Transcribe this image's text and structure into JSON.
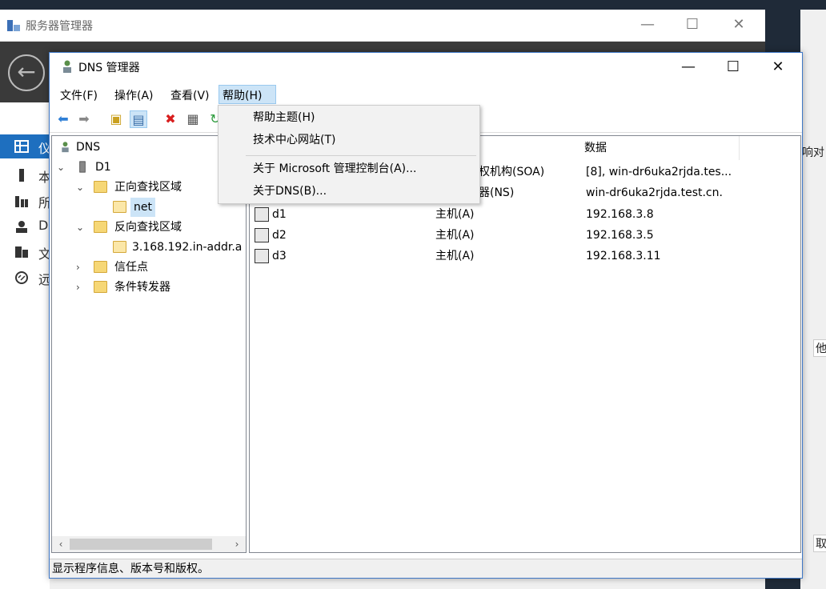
{
  "server_manager": {
    "title": "服务器管理器",
    "nav": [
      {
        "label": "仪",
        "icon": "dashboard-icon",
        "active": true
      },
      {
        "label": "本",
        "icon": "local-server-icon"
      },
      {
        "label": "所",
        "icon": "all-servers-icon"
      },
      {
        "label": "D",
        "icon": "dns-role-icon"
      },
      {
        "label": "文",
        "icon": "file-services-icon"
      },
      {
        "label": "远",
        "icon": "remote-access-icon"
      }
    ],
    "right_fragments": {
      "a": "响对",
      "b": "他",
      "c": "取"
    }
  },
  "dns_window": {
    "title": "DNS 管理器",
    "menu": {
      "file": "文件(F)",
      "action": "操作(A)",
      "view": "查看(V)",
      "help": "帮助(H)"
    },
    "help_menu": [
      "帮助主题(H)",
      "技术中心网站(T)",
      "关于 Microsoft 管理控制台(A)...",
      "关于DNS(B)..."
    ],
    "tree": {
      "root": "DNS",
      "server": "D1",
      "forward": "正向查找区域",
      "forward_zone": "net",
      "reverse": "反向查找区域",
      "reverse_zone": "3.168.192.in-addr.a",
      "trust": "信任点",
      "forwarders": "条件转发器"
    },
    "list": {
      "header_data": "数据",
      "rows": [
        {
          "name": "",
          "type": "权机构(SOA)",
          "data": "[8], win-dr6uka2rjda.tes..."
        },
        {
          "name": "",
          "type": "器(NS)",
          "data": "win-dr6uka2rjda.test.cn."
        },
        {
          "name": "d1",
          "type": "主机(A)",
          "data": "192.168.3.8"
        },
        {
          "name": "d2",
          "type": "主机(A)",
          "data": "192.168.3.5"
        },
        {
          "name": "d3",
          "type": "主机(A)",
          "data": "192.168.3.11"
        }
      ]
    },
    "status": "显示程序信息、版本号和版权。"
  }
}
